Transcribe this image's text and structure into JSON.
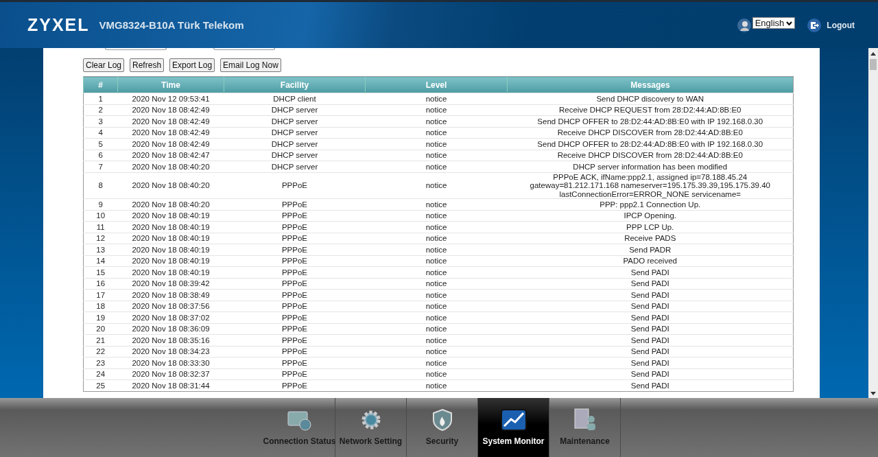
{
  "header": {
    "brand": "ZYXEL",
    "model": "VMG8324-B10A Türk Telekom",
    "language": "English",
    "logout": "Logout"
  },
  "toolbar": [
    "Clear Log",
    "Refresh",
    "Export Log",
    "Email Log Now"
  ],
  "table": {
    "columns": [
      "#",
      "Time",
      "Facility",
      "Level",
      "Messages"
    ],
    "rows": [
      [
        "1",
        "2020 Nov 12 09:53:41",
        "DHCP client",
        "notice",
        "Send DHCP discovery to WAN"
      ],
      [
        "2",
        "2020 Nov 18 08:42:49",
        "DHCP server",
        "notice",
        "Receive DHCP REQUEST from 28:D2:44:AD:8B:E0"
      ],
      [
        "3",
        "2020 Nov 18 08:42:49",
        "DHCP server",
        "notice",
        "Send DHCP OFFER to 28:D2:44:AD:8B:E0 with IP 192.168.0.30"
      ],
      [
        "4",
        "2020 Nov 18 08:42:49",
        "DHCP server",
        "notice",
        "Receive DHCP DISCOVER from 28:D2:44:AD:8B:E0"
      ],
      [
        "5",
        "2020 Nov 18 08:42:49",
        "DHCP server",
        "notice",
        "Send DHCP OFFER to 28:D2:44:AD:8B:E0 with IP 192.168.0.30"
      ],
      [
        "6",
        "2020 Nov 18 08:42:47",
        "DHCP server",
        "notice",
        "Receive DHCP DISCOVER from 28:D2:44:AD:8B:E0"
      ],
      [
        "7",
        "2020 Nov 18 08:40:20",
        "DHCP server",
        "notice",
        "DHCP server information has been modified"
      ],
      [
        "8",
        "2020 Nov 18 08:40:20",
        "PPPoE",
        "notice",
        "PPPoE ACK, ifName:ppp2.1, assigned ip=78.188.45.24\ngateway=81.212.171.168 nameserver=195.175.39.39,195.175.39.40\nlastConnectionError=ERROR_NONE servicename="
      ],
      [
        "9",
        "2020 Nov 18 08:40:20",
        "PPPoE",
        "notice",
        "PPP: ppp2.1 Connection Up."
      ],
      [
        "10",
        "2020 Nov 18 08:40:19",
        "PPPoE",
        "notice",
        "IPCP Opening."
      ],
      [
        "11",
        "2020 Nov 18 08:40:19",
        "PPPoE",
        "notice",
        "PPP LCP Up."
      ],
      [
        "12",
        "2020 Nov 18 08:40:19",
        "PPPoE",
        "notice",
        "Receive PADS"
      ],
      [
        "13",
        "2020 Nov 18 08:40:19",
        "PPPoE",
        "notice",
        "Send PADR"
      ],
      [
        "14",
        "2020 Nov 18 08:40:19",
        "PPPoE",
        "notice",
        "PADO received"
      ],
      [
        "15",
        "2020 Nov 18 08:40:19",
        "PPPoE",
        "notice",
        "Send PADI"
      ],
      [
        "16",
        "2020 Nov 18 08:39:42",
        "PPPoE",
        "notice",
        "Send PADI"
      ],
      [
        "17",
        "2020 Nov 18 08:38:49",
        "PPPoE",
        "notice",
        "Send PADI"
      ],
      [
        "18",
        "2020 Nov 18 08:37:56",
        "PPPoE",
        "notice",
        "Send PADI"
      ],
      [
        "19",
        "2020 Nov 18 08:37:02",
        "PPPoE",
        "notice",
        "Send PADI"
      ],
      [
        "20",
        "2020 Nov 18 08:36:09",
        "PPPoE",
        "notice",
        "Send PADI"
      ],
      [
        "21",
        "2020 Nov 18 08:35:16",
        "PPPoE",
        "notice",
        "Send PADI"
      ],
      [
        "22",
        "2020 Nov 18 08:34:23",
        "PPPoE",
        "notice",
        "Send PADI"
      ],
      [
        "23",
        "2020 Nov 18 08:33:30",
        "PPPoE",
        "notice",
        "Send PADI"
      ],
      [
        "24",
        "2020 Nov 18 08:32:37",
        "PPPoE",
        "notice",
        "Send PADI"
      ],
      [
        "25",
        "2020 Nov 18 08:31:44",
        "PPPoE",
        "notice",
        "Send PADI"
      ]
    ]
  },
  "nav": [
    {
      "label": "Connection Status",
      "kind": "monitor",
      "selected": false
    },
    {
      "label": "Network Setting",
      "kind": "gear",
      "selected": false
    },
    {
      "label": "Security",
      "kind": "shield",
      "selected": false
    },
    {
      "label": "System Monitor",
      "kind": "chart",
      "selected": true
    },
    {
      "label": "Maintenance",
      "kind": "tools",
      "selected": false
    }
  ]
}
